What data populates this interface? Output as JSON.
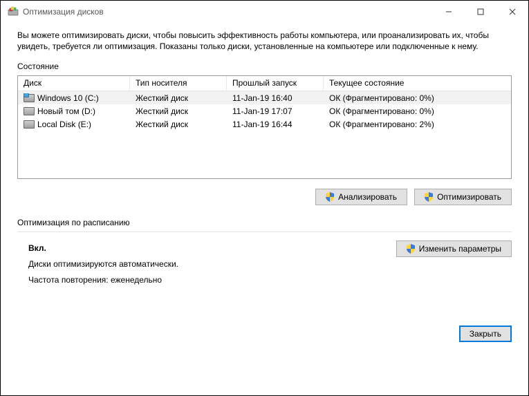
{
  "window": {
    "title": "Оптимизация дисков"
  },
  "intro": "Вы можете оптимизировать диски, чтобы повысить эффективность работы компьютера, или проанализировать их, чтобы увидеть, требуется ли оптимизация. Показаны только диски, установленные на компьютере или подключенные к нему.",
  "status_label": "Состояние",
  "columns": {
    "disk": "Диск",
    "media": "Тип носителя",
    "last_run": "Прошлый запуск",
    "current": "Текущее состояние"
  },
  "rows": [
    {
      "name": "Windows 10 (C:)",
      "media": "Жесткий диск",
      "last_run": "11-Jan-19 16:40",
      "current": "ОК (Фрагментировано: 0%)",
      "os": true
    },
    {
      "name": "Новый том (D:)",
      "media": "Жесткий диск",
      "last_run": "11-Jan-19 17:07",
      "current": "ОК (Фрагментировано: 0%)",
      "os": false
    },
    {
      "name": "Local Disk (E:)",
      "media": "Жесткий диск",
      "last_run": "11-Jan-19 16:44",
      "current": "ОК (Фрагментировано: 2%)",
      "os": false
    }
  ],
  "buttons": {
    "analyze": "Анализировать",
    "optimize": "Оптимизировать",
    "change": "Изменить параметры",
    "close": "Закрыть"
  },
  "schedule": {
    "heading": "Оптимизация по расписанию",
    "on": "Вкл.",
    "auto": "Диски оптимизируются автоматически.",
    "freq": "Частота повторения: еженедельно"
  }
}
